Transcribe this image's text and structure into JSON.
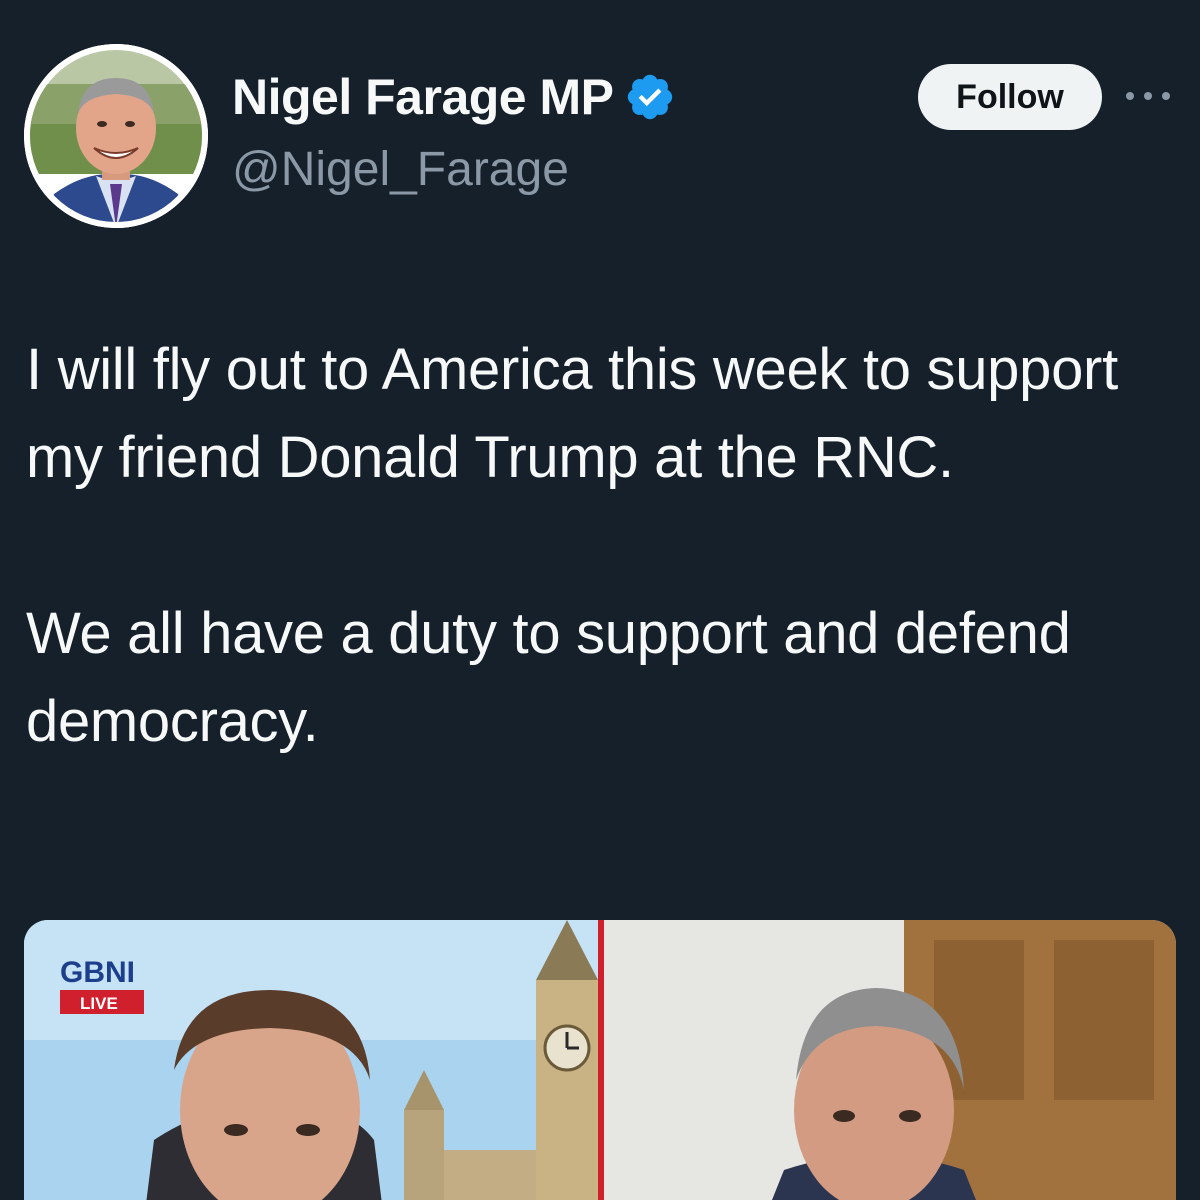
{
  "tweet": {
    "author": {
      "display_name": "Nigel Farage MP",
      "handle": "@Nigel_Farage",
      "verified": true,
      "avatar_icon": "profile-photo"
    },
    "actions": {
      "follow_label": "Follow",
      "more_icon": "more-horizontal-icon"
    },
    "text_paragraphs": [
      "I will fly out to America this week to support my friend Donald Trump at the RNC.",
      "We all have a duty to support and defend democracy."
    ],
    "media": {
      "channel_logo": "GBNI",
      "live_label": "LIVE"
    }
  },
  "colors": {
    "background": "#15202b",
    "text_primary": "#f7f9f9",
    "text_secondary": "#8b98a5",
    "verified_blue": "#1d9bf0",
    "follow_bg": "#eff3f4"
  }
}
